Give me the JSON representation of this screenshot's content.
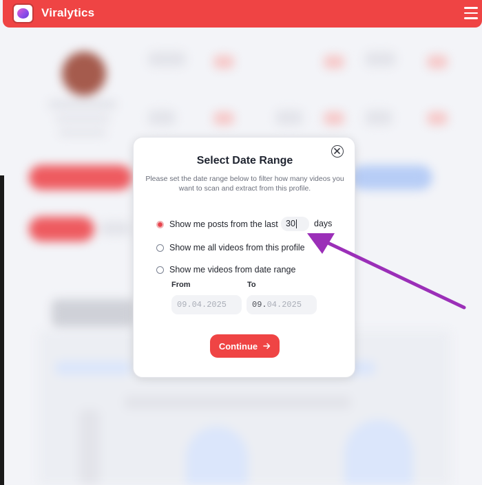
{
  "app": {
    "name": "Viralytics"
  },
  "modal": {
    "title": "Select Date Range",
    "description": "Please set the date range below to filter how many videos you want to scan and extract from this profile.",
    "options": [
      {
        "label": "Show me posts from the last",
        "selected": true
      },
      {
        "label": "Show me all videos from this profile",
        "selected": false
      },
      {
        "label": "Show me videos from date range",
        "selected": false
      }
    ],
    "days_value": "30",
    "days_suffix": "days",
    "from_label": "From",
    "to_label": "To",
    "from_date": "09.04.2025",
    "to_date_prefix": "09.",
    "to_date_rest": "04.2025",
    "continue_label": "Continue",
    "continue_icon": "arrow-right-icon"
  },
  "colors": {
    "brand": "#ef4444",
    "annotation_arrow": "#9b2fb8",
    "radio_selected": "#e8434c"
  }
}
